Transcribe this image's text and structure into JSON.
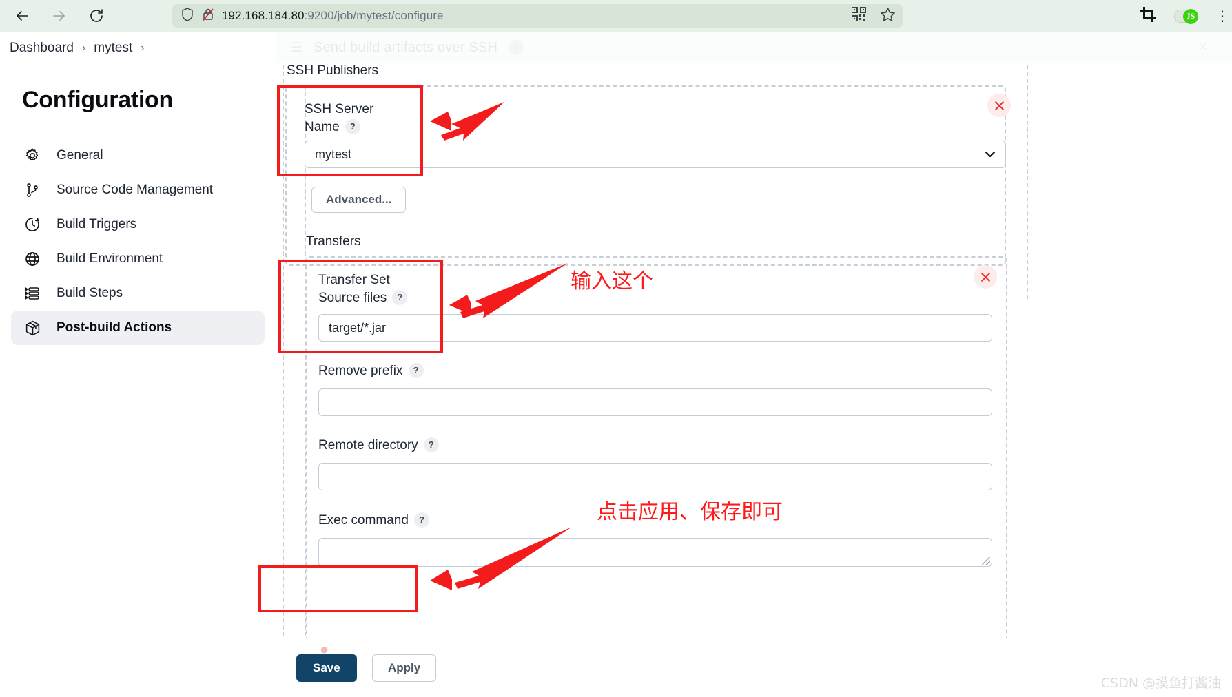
{
  "browser": {
    "url_host": "192.168.184.80",
    "url_rest": ":9200/job/mytest/configure",
    "back_icon": "back-arrow-icon",
    "forward_icon": "forward-arrow-icon",
    "reload_icon": "reload-icon",
    "shield_icon": "shield-icon",
    "no_lock_icon": "lock-crossed-icon",
    "qr_icon": "qr-code-icon",
    "bookmark_icon": "star-bookmark-icon",
    "crop_icon": "crop-screenshot-icon",
    "js_toggle_label": "JS"
  },
  "breadcrumb": {
    "items": [
      "Dashboard",
      "mytest"
    ],
    "separator": "›"
  },
  "ghost_header": {
    "title": "Send build artifacts over SSH",
    "menu_icon": "hamburger-icon",
    "help": "?",
    "close": "×"
  },
  "sidebar": {
    "title": "Configuration",
    "items": [
      {
        "label": "General",
        "icon": "gear-icon",
        "active": false
      },
      {
        "label": "Source Code Management",
        "icon": "git-branch-icon",
        "active": false
      },
      {
        "label": "Build Triggers",
        "icon": "clock-icon",
        "active": false
      },
      {
        "label": "Build Environment",
        "icon": "globe-icon",
        "active": false
      },
      {
        "label": "Build Steps",
        "icon": "list-steps-icon",
        "active": false
      },
      {
        "label": "Post-build Actions",
        "icon": "package-box-icon",
        "active": true
      }
    ]
  },
  "main": {
    "ssh_publishers_label": "SSH Publishers",
    "ssh_server": {
      "label_line1": "SSH Server",
      "label_line2": "Name",
      "help": "?",
      "value": "mytest",
      "chevron": "∨",
      "remove": "×"
    },
    "advanced_button": "Advanced...",
    "transfers_label": "Transfers",
    "transfer_set": {
      "label_line1": "Transfer Set",
      "label_line2": "Source files",
      "help": "?",
      "value": "target/*.jar",
      "remove": "×"
    },
    "fields": [
      {
        "label": "Remove prefix",
        "help": "?",
        "value": ""
      },
      {
        "label": "Remote directory",
        "help": "?",
        "value": ""
      }
    ],
    "exec_command": {
      "label": "Exec command",
      "help": "?",
      "value": ""
    },
    "save_button": "Save",
    "apply_button": "Apply"
  },
  "annotations": {
    "note_input": "输入这个",
    "note_click": "点击应用、保存即可",
    "highlight_color": "#f31b1b",
    "watermark": "CSDN @摸鱼打酱油"
  }
}
